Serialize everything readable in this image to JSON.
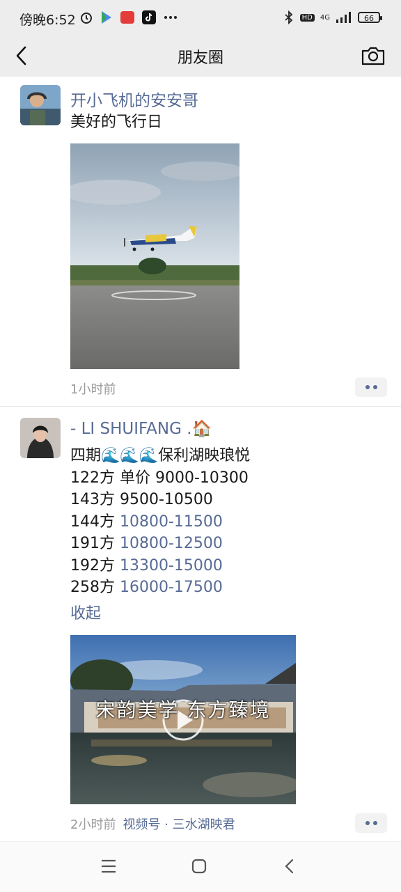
{
  "status_bar": {
    "time": "傍晚6:52",
    "battery": "66",
    "network": "4G",
    "hd": "HD"
  },
  "nav": {
    "title": "朋友圈"
  },
  "posts": [
    {
      "username": "开小飞机的安安哥",
      "text": "美好的飞行日",
      "time": "1小时前"
    },
    {
      "username": "- LI SHUIFANG .🏠",
      "lines": [
        {
          "label": "四期🌊🌊🌊保利湖映琅悦",
          "value": ""
        },
        {
          "label": "122方  单价 ",
          "value": "9000-10300",
          "linked": false
        },
        {
          "label": "143方 ",
          "value": "9500-10500",
          "linked": false
        },
        {
          "label": "144方 ",
          "value": "10800-11500",
          "linked": true
        },
        {
          "label": "191方 ",
          "value": "10800-12500",
          "linked": true
        },
        {
          "label": "192方 ",
          "value": "13300-15000",
          "linked": true
        },
        {
          "label": "258方 ",
          "value": "16000-17500",
          "linked": true
        }
      ],
      "collapse": "收起",
      "video_caption": "宋韵美学 东方臻境",
      "time": "2小时前",
      "source": "视频号 · 三水湖映君"
    }
  ],
  "colors": {
    "link": "#576b95",
    "bg_bar": "#ededed",
    "time_gray": "#9a9a9a"
  }
}
